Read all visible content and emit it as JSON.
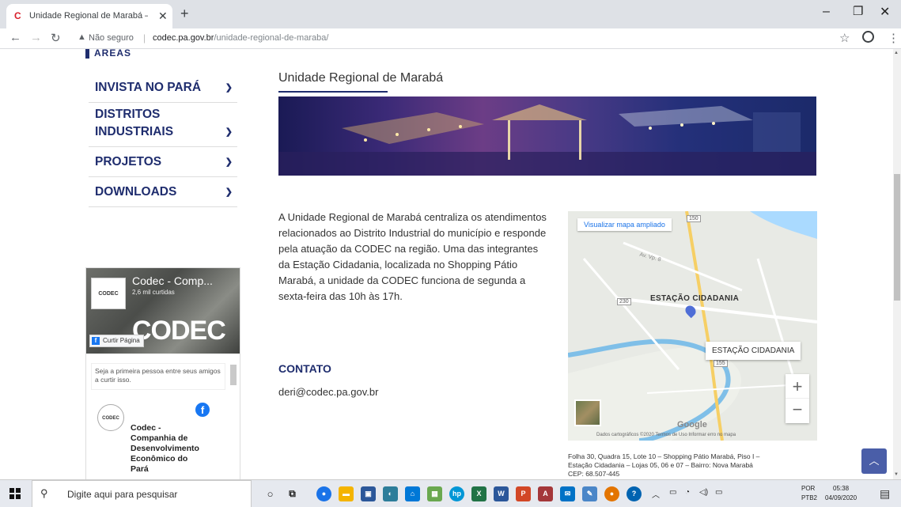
{
  "browser": {
    "tab_title": "Unidade Regional de Marabá – C",
    "new_tab": "+",
    "security_label": "Não seguro",
    "url_host": "codec.pa.gov.br",
    "url_path": "/unidade-regional-de-maraba/"
  },
  "sidebar": {
    "areas_heading": "ÁREAS",
    "items": [
      {
        "label_line1": "INVISTA NO PARÁ",
        "label_line2": ""
      },
      {
        "label_line1": "DISTRITOS",
        "label_line2": "INDUSTRIAIS"
      },
      {
        "label_line1": "PROJETOS",
        "label_line2": ""
      },
      {
        "label_line1": "DOWNLOADS",
        "label_line2": ""
      }
    ]
  },
  "facebook": {
    "page_name": "Codec - Comp...",
    "likes": "2,6 mil curtidas",
    "cover_text": "CODEC",
    "logo_text": "CODEC",
    "like_button": "Curtir Página",
    "note": "Seja a primeira pessoa entre seus amigos a curtir isso.",
    "org_line1": "Codec -",
    "org_line2": "Companhia de",
    "org_line3": "Desenvolvimento",
    "org_line4": "Econômico do",
    "org_line5": "Pará"
  },
  "main": {
    "title": "Unidade Regional de Marabá",
    "intro": "A Unidade Regional de Marabá centraliza os atendimentos relacionados ao Distrito Industrial do município e responde pela atuação da CODEC na região. Uma das integrantes da Estação Cidadania, localizada no Shopping Pátio Marabá, a unidade da CODEC funciona de segunda a sexta-feira das 10h às 17h.",
    "contato_heading": "CONTATO",
    "email": "deri@codec.pa.gov.br"
  },
  "map": {
    "view_larger": "Visualizar mapa ampliado",
    "road_150": "150",
    "road_230": "230",
    "road_155": "155",
    "street": "Av. Vp. 8",
    "place_label": "ESTAÇÃO CIDADANIA",
    "tooltip": "ESTAÇÃO CIDADANIA",
    "zoom_in": "+",
    "zoom_out": "−",
    "google": "Google",
    "footer": "Dados cartográficos ©2020   Termos de Uso   Informar erro no mapa"
  },
  "address": {
    "line1": "Folha 30, Quadra 15, Lote 10 – Shopping Pátio Marabá, Piso I –",
    "line2": "Estação Cidadania – Lojas 05, 06 e 07 – Bairro: Nova Marabá",
    "line3": "CEP: 68.507-445"
  },
  "taskbar": {
    "search_placeholder": "Digite aqui para pesquisar",
    "lang1": "POR",
    "lang2": "PTB2",
    "time": "05:38",
    "date": "04/09/2020"
  },
  "colors": {
    "brand_navy": "#1f2d6e",
    "facebook_blue": "#1877f2",
    "back_to_top": "#4a5ea8"
  }
}
